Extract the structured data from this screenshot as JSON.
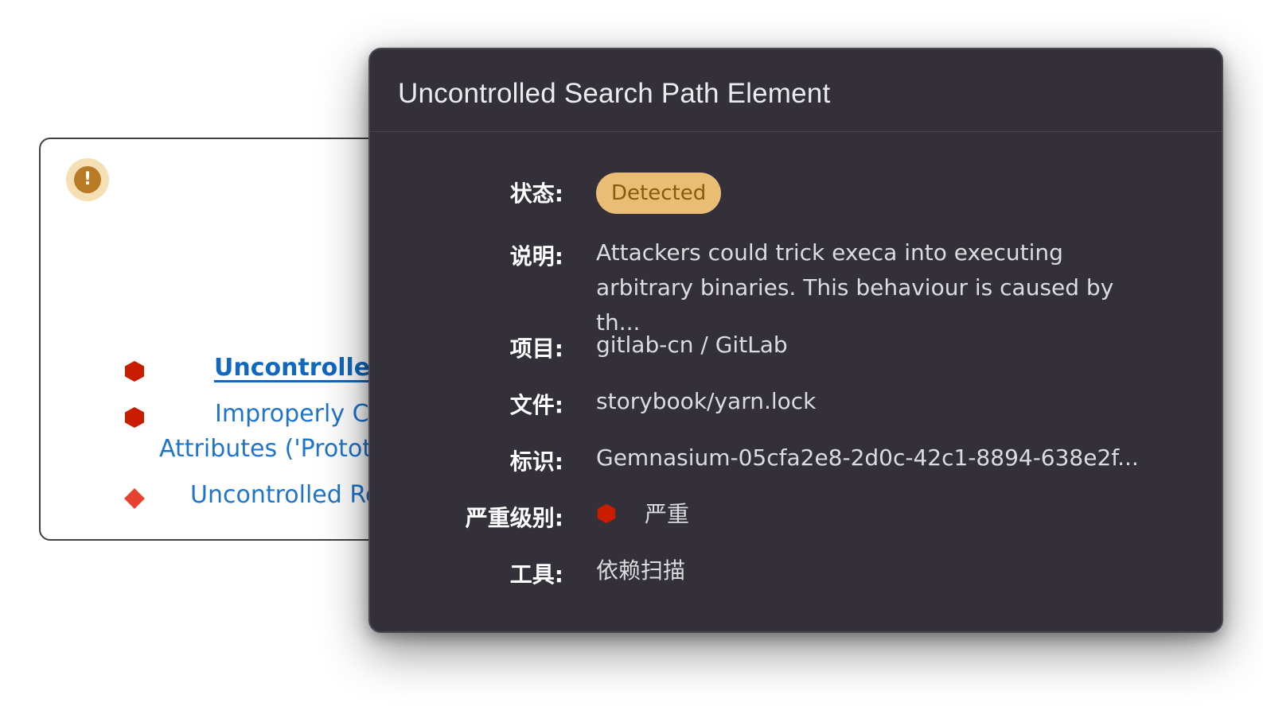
{
  "background_list": {
    "items": [
      {
        "label": "Uncontrolled",
        "active": true
      },
      {
        "label": "Improperly Co",
        "continuation": "Attributes ('Protot"
      },
      {
        "label": "Uncontrolled Re"
      }
    ]
  },
  "popover": {
    "title": "Uncontrolled Search Path Element",
    "fields": {
      "status_label": "状态:",
      "status_value": "Detected",
      "description_label": "说明:",
      "description_line1": "Attackers could trick execa into executing",
      "description_line2": "arbitrary binaries. This behaviour is caused by th...",
      "project_label": "项目:",
      "project_value": "gitlab-cn / GitLab",
      "file_label": "文件:",
      "file_value": "storybook/yarn.lock",
      "identifier_label": "标识:",
      "identifier_value": "Gemnasium-05cfa2e8-2d0c-42c1-8894-638e2f...",
      "severity_label": "严重级别:",
      "severity_value": "严重",
      "tool_label": "工具:",
      "tool_value": "依赖扫描"
    }
  },
  "colors": {
    "critical": "#c91c00",
    "high": "#e9412f",
    "link": "#1f75cb",
    "popover_bg": "#333039",
    "status_pill_bg": "#e9be74",
    "warning_badge": "#b87a25"
  },
  "icons": {
    "warning": "exclamation-circle-icon",
    "critical": "severity-critical-hexagon-icon",
    "high": "severity-high-diamond-icon"
  }
}
